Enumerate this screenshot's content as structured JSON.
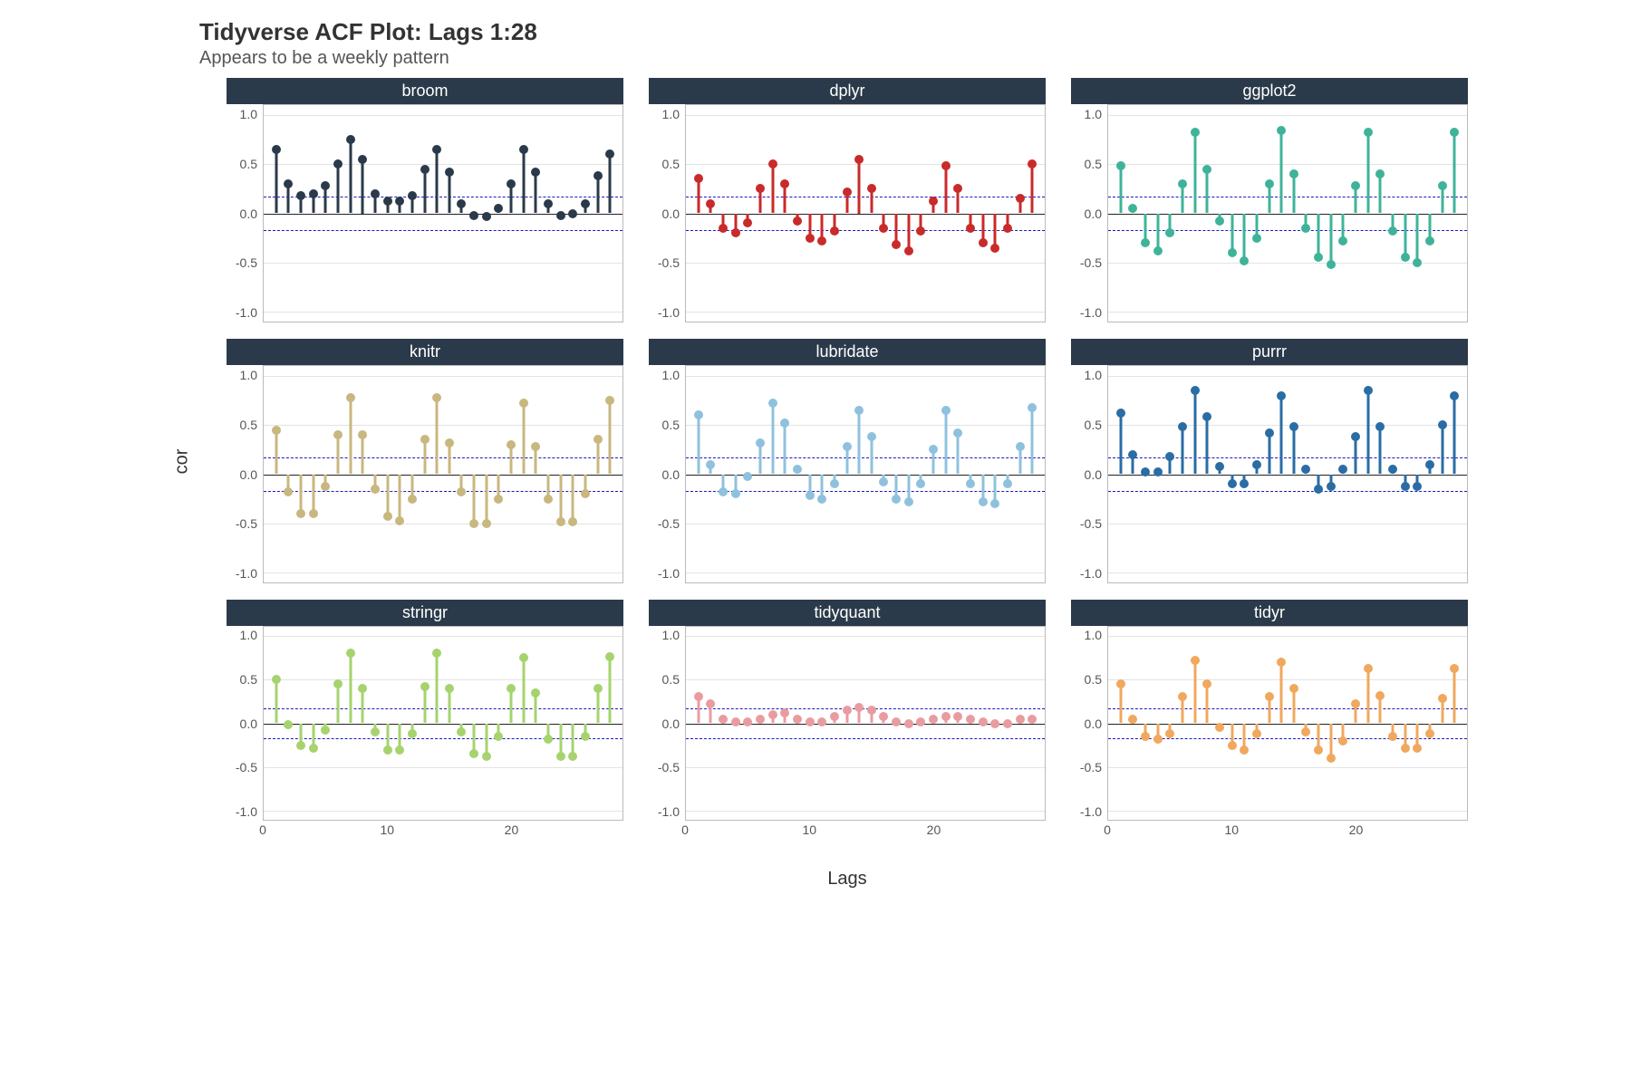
{
  "title": "Tidyverse ACF Plot: Lags 1:28",
  "subtitle": "Appears to be a weekly pattern",
  "ylabel": "cor",
  "xlabel": "Lags",
  "ylim": [
    -1.1,
    1.1
  ],
  "yticks": [
    -1.0,
    -0.5,
    0.0,
    0.5,
    1.0
  ],
  "xlim": [
    0,
    29
  ],
  "xticks": [
    0,
    10,
    20
  ],
  "ci": 0.17,
  "lags": [
    1,
    2,
    3,
    4,
    5,
    6,
    7,
    8,
    9,
    10,
    11,
    12,
    13,
    14,
    15,
    16,
    17,
    18,
    19,
    20,
    21,
    22,
    23,
    24,
    25,
    26,
    27,
    28
  ],
  "panels": [
    "broom",
    "dplyr",
    "ggplot2",
    "knitr",
    "lubridate",
    "purrr",
    "stringr",
    "tidyquant",
    "tidyr"
  ],
  "chart_data": [
    {
      "type": "bar",
      "name": "broom",
      "color": "#2b3a4a",
      "categories": [
        1,
        2,
        3,
        4,
        5,
        6,
        7,
        8,
        9,
        10,
        11,
        12,
        13,
        14,
        15,
        16,
        17,
        18,
        19,
        20,
        21,
        22,
        23,
        24,
        25,
        26,
        27,
        28
      ],
      "values": [
        0.65,
        0.3,
        0.18,
        0.2,
        0.28,
        0.5,
        0.75,
        0.55,
        0.2,
        0.12,
        0.12,
        0.18,
        0.45,
        0.65,
        0.42,
        0.1,
        -0.02,
        -0.03,
        0.05,
        0.3,
        0.65,
        0.42,
        0.1,
        -0.02,
        0.0,
        0.1,
        0.38,
        0.6
      ],
      "xlabel": "Lags",
      "ylabel": "cor",
      "ylim": [
        -1.1,
        1.1
      ]
    },
    {
      "type": "bar",
      "name": "dplyr",
      "color": "#c92a2a",
      "categories": [
        1,
        2,
        3,
        4,
        5,
        6,
        7,
        8,
        9,
        10,
        11,
        12,
        13,
        14,
        15,
        16,
        17,
        18,
        19,
        20,
        21,
        22,
        23,
        24,
        25,
        26,
        27,
        28
      ],
      "values": [
        0.35,
        0.1,
        -0.15,
        -0.2,
        -0.1,
        0.25,
        0.5,
        0.3,
        -0.08,
        -0.25,
        -0.28,
        -0.18,
        0.22,
        0.55,
        0.25,
        -0.15,
        -0.32,
        -0.38,
        -0.18,
        0.12,
        0.48,
        0.25,
        -0.15,
        -0.3,
        -0.35,
        -0.15,
        0.15,
        0.5
      ],
      "xlabel": "Lags",
      "ylabel": "cor",
      "ylim": [
        -1.1,
        1.1
      ]
    },
    {
      "type": "bar",
      "name": "ggplot2",
      "color": "#3fb39a",
      "categories": [
        1,
        2,
        3,
        4,
        5,
        6,
        7,
        8,
        9,
        10,
        11,
        12,
        13,
        14,
        15,
        16,
        17,
        18,
        19,
        20,
        21,
        22,
        23,
        24,
        25,
        26,
        27,
        28
      ],
      "values": [
        0.48,
        0.05,
        -0.3,
        -0.38,
        -0.2,
        0.3,
        0.82,
        0.45,
        -0.08,
        -0.4,
        -0.48,
        -0.25,
        0.3,
        0.84,
        0.4,
        -0.15,
        -0.45,
        -0.52,
        -0.28,
        0.28,
        0.82,
        0.4,
        -0.18,
        -0.45,
        -0.5,
        -0.28,
        0.28,
        0.82
      ],
      "xlabel": "Lags",
      "ylabel": "cor",
      "ylim": [
        -1.1,
        1.1
      ]
    },
    {
      "type": "bar",
      "name": "knitr",
      "color": "#c8b77f",
      "categories": [
        1,
        2,
        3,
        4,
        5,
        6,
        7,
        8,
        9,
        10,
        11,
        12,
        13,
        14,
        15,
        16,
        17,
        18,
        19,
        20,
        21,
        22,
        23,
        24,
        25,
        26,
        27,
        28
      ],
      "values": [
        0.45,
        -0.18,
        -0.4,
        -0.4,
        -0.12,
        0.4,
        0.78,
        0.4,
        -0.15,
        -0.43,
        -0.47,
        -0.25,
        0.35,
        0.78,
        0.32,
        -0.18,
        -0.5,
        -0.5,
        -0.25,
        0.3,
        0.72,
        0.28,
        -0.25,
        -0.48,
        -0.48,
        -0.2,
        0.35,
        0.75
      ],
      "xlabel": "Lags",
      "ylabel": "cor",
      "ylim": [
        -1.1,
        1.1
      ]
    },
    {
      "type": "bar",
      "name": "lubridate",
      "color": "#8fc1de",
      "categories": [
        1,
        2,
        3,
        4,
        5,
        6,
        7,
        8,
        9,
        10,
        11,
        12,
        13,
        14,
        15,
        16,
        17,
        18,
        19,
        20,
        21,
        22,
        23,
        24,
        25,
        26,
        27,
        28
      ],
      "values": [
        0.6,
        0.1,
        -0.18,
        -0.2,
        -0.02,
        0.32,
        0.72,
        0.52,
        0.05,
        -0.22,
        -0.25,
        -0.1,
        0.28,
        0.65,
        0.38,
        -0.08,
        -0.25,
        -0.28,
        -0.1,
        0.25,
        0.65,
        0.42,
        -0.1,
        -0.28,
        -0.3,
        -0.1,
        0.28,
        0.68
      ],
      "xlabel": "Lags",
      "ylabel": "cor",
      "ylim": [
        -1.1,
        1.1
      ]
    },
    {
      "type": "bar",
      "name": "purrr",
      "color": "#2a6da4",
      "categories": [
        1,
        2,
        3,
        4,
        5,
        6,
        7,
        8,
        9,
        10,
        11,
        12,
        13,
        14,
        15,
        16,
        17,
        18,
        19,
        20,
        21,
        22,
        23,
        24,
        25,
        26,
        27,
        28
      ],
      "values": [
        0.62,
        0.2,
        0.02,
        0.02,
        0.18,
        0.48,
        0.85,
        0.58,
        0.08,
        -0.1,
        -0.1,
        0.1,
        0.42,
        0.8,
        0.48,
        0.05,
        -0.15,
        -0.12,
        0.05,
        0.38,
        0.85,
        0.48,
        0.05,
        -0.12,
        -0.12,
        0.1,
        0.5,
        0.8
      ],
      "xlabel": "Lags",
      "ylabel": "cor",
      "ylim": [
        -1.1,
        1.1
      ]
    },
    {
      "type": "bar",
      "name": "stringr",
      "color": "#a6d36e",
      "categories": [
        1,
        2,
        3,
        4,
        5,
        6,
        7,
        8,
        9,
        10,
        11,
        12,
        13,
        14,
        15,
        16,
        17,
        18,
        19,
        20,
        21,
        22,
        23,
        24,
        25,
        26,
        27,
        28
      ],
      "values": [
        0.5,
        -0.02,
        -0.25,
        -0.28,
        -0.08,
        0.45,
        0.8,
        0.4,
        -0.1,
        -0.3,
        -0.3,
        -0.12,
        0.42,
        0.8,
        0.4,
        -0.1,
        -0.35,
        -0.38,
        -0.15,
        0.4,
        0.75,
        0.35,
        -0.18,
        -0.38,
        -0.38,
        -0.15,
        0.4,
        0.76
      ],
      "xlabel": "Lags",
      "ylabel": "cor",
      "ylim": [
        -1.1,
        1.1
      ]
    },
    {
      "type": "bar",
      "name": "tidyquant",
      "color": "#e99ca0",
      "categories": [
        1,
        2,
        3,
        4,
        5,
        6,
        7,
        8,
        9,
        10,
        11,
        12,
        13,
        14,
        15,
        16,
        17,
        18,
        19,
        20,
        21,
        22,
        23,
        24,
        25,
        26,
        27,
        28
      ],
      "values": [
        0.3,
        0.22,
        0.05,
        0.02,
        0.02,
        0.05,
        0.1,
        0.12,
        0.05,
        0.02,
        0.02,
        0.08,
        0.15,
        0.18,
        0.15,
        0.08,
        0.02,
        0.0,
        0.02,
        0.05,
        0.08,
        0.08,
        0.05,
        0.02,
        0.0,
        0.0,
        0.05,
        0.05
      ],
      "xlabel": "Lags",
      "ylabel": "cor",
      "ylim": [
        -1.1,
        1.1
      ]
    },
    {
      "type": "bar",
      "name": "tidyr",
      "color": "#f0a85e",
      "categories": [
        1,
        2,
        3,
        4,
        5,
        6,
        7,
        8,
        9,
        10,
        11,
        12,
        13,
        14,
        15,
        16,
        17,
        18,
        19,
        20,
        21,
        22,
        23,
        24,
        25,
        26,
        27,
        28
      ],
      "values": [
        0.45,
        0.05,
        -0.15,
        -0.18,
        -0.12,
        0.3,
        0.72,
        0.45,
        -0.05,
        -0.25,
        -0.3,
        -0.12,
        0.3,
        0.7,
        0.4,
        -0.1,
        -0.3,
        -0.4,
        -0.2,
        0.22,
        0.62,
        0.32,
        -0.15,
        -0.28,
        -0.28,
        -0.12,
        0.28,
        0.63
      ],
      "xlabel": "Lags",
      "ylabel": "cor",
      "ylim": [
        -1.1,
        1.1
      ]
    }
  ]
}
